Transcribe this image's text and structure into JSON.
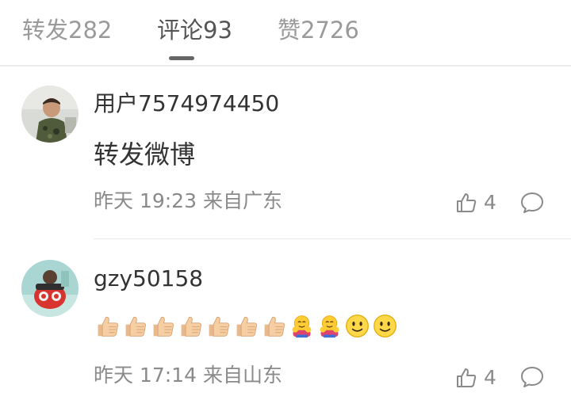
{
  "tabs": [
    {
      "label": "转发282"
    },
    {
      "label": "评论93"
    },
    {
      "label": "赞2726"
    }
  ],
  "comments": [
    {
      "username": "用户7574974450",
      "text": "转发微博",
      "meta": "昨天 19:23 来自广东",
      "likes": "4"
    },
    {
      "username": "gzy50158",
      "emojis": [
        "thumbs-up",
        "thumbs-up",
        "thumbs-up",
        "thumbs-up",
        "thumbs-up",
        "thumbs-up",
        "thumbs-up",
        "hugging-face",
        "hugging-face",
        "smile-face",
        "smile-face"
      ],
      "meta": "昨天 17:14 来自山东",
      "likes": "4"
    }
  ],
  "icons": {
    "like": "thumbs-up-outline-icon",
    "reply": "speech-bubble-icon"
  },
  "colors": {
    "text_primary": "#333333",
    "text_secondary": "#8a8a8a",
    "tab_inactive": "#9a9a9a",
    "divider": "#e8e8e8"
  }
}
